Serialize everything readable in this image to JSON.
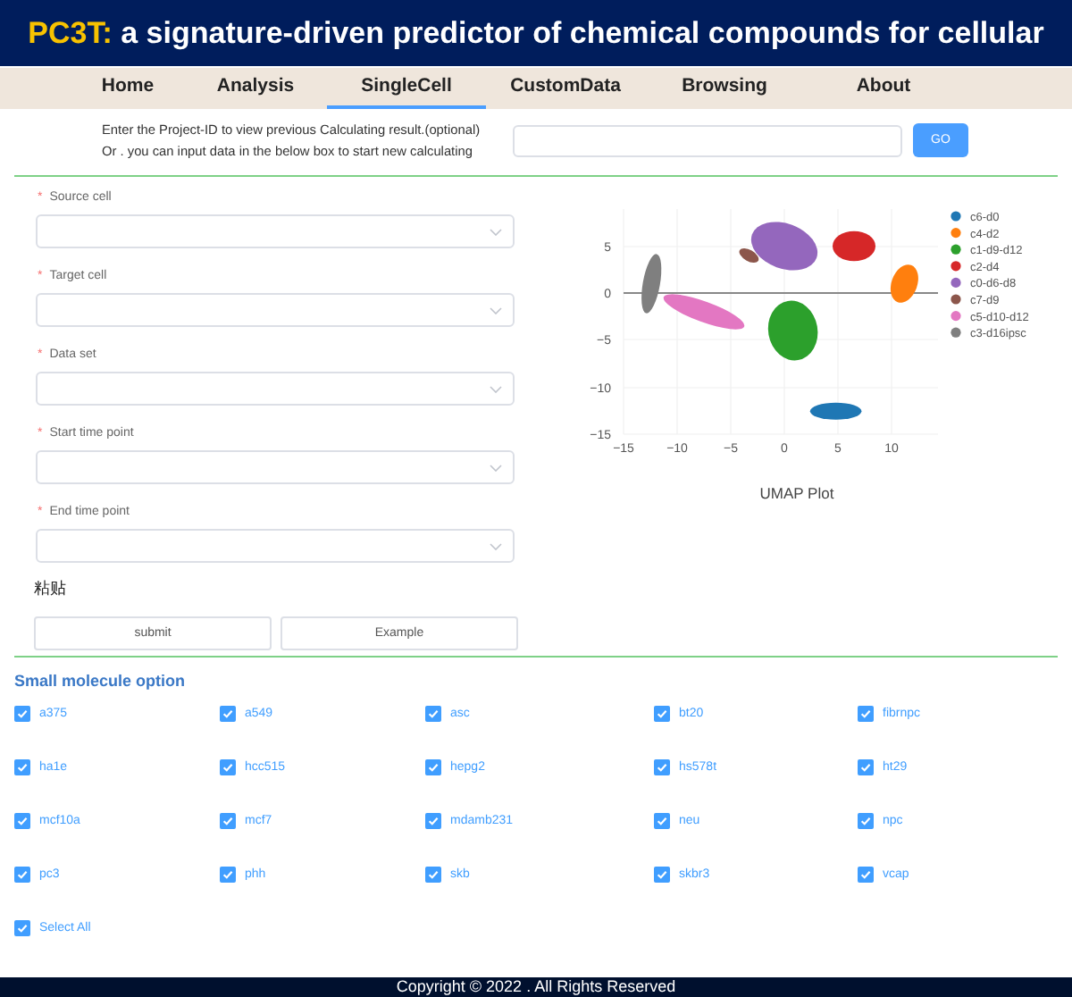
{
  "header": {
    "title_prefix": "PC3T:",
    "title": "a signature-driven predictor of chemical compounds for cellular"
  },
  "nav": [
    {
      "label": "Home",
      "selected": false
    },
    {
      "label": "Analysis",
      "selected": false
    },
    {
      "label": "SingleCell",
      "selected": true
    },
    {
      "label": "CustomData",
      "selected": false
    },
    {
      "label": "Browsing",
      "selected": false
    },
    {
      "label": "About",
      "selected": false
    }
  ],
  "project": {
    "lines": [
      "Enter the Project-ID to view previous Calculating result.(optional)",
      "Or . you can input data in the below box to start new calculating"
    ],
    "button": "GO"
  },
  "form": {
    "fields": [
      {
        "label": "Source cell",
        "required_mark": "*"
      },
      {
        "label": "Target cell",
        "required_mark": "*"
      },
      {
        "label": "Data set",
        "required_mark": "*"
      },
      {
        "label": "Start time point",
        "required_mark": "*"
      },
      {
        "label": "End time point",
        "required_mark": "*"
      }
    ],
    "paste_label": "粘贴",
    "buttons": [
      "submit",
      "Example"
    ]
  },
  "plot": {
    "caption": "UMAP Plot",
    "xticks": [
      "−15",
      "−10",
      "−5",
      "0",
      "5",
      "10"
    ],
    "yticks": [
      "5",
      "0",
      "−5",
      "−10",
      "−15"
    ],
    "legend": [
      {
        "label": "c6-d0",
        "color": "#1f77b4"
      },
      {
        "label": "c4-d2",
        "color": "#ff7f0e"
      },
      {
        "label": "c1-d9-d12",
        "color": "#2ca02c"
      },
      {
        "label": "c2-d4",
        "color": "#d62728"
      },
      {
        "label": "c0-d6-d8",
        "color": "#9467bd"
      },
      {
        "label": "c7-d9",
        "color": "#8c564b"
      },
      {
        "label": "c5-d10-d12",
        "color": "#e377c2"
      },
      {
        "label": "c3-d16ipsc",
        "color": "#7f7f7f"
      }
    ]
  },
  "molecules": {
    "title": "Small molecule option",
    "options": [
      {
        "label": "a375",
        "checked": true
      },
      {
        "label": "a549",
        "checked": true
      },
      {
        "label": "asc",
        "checked": true
      },
      {
        "label": "bt20",
        "checked": true
      },
      {
        "label": "fibrnpc",
        "checked": true
      },
      {
        "label": "ha1e",
        "checked": true
      },
      {
        "label": "hcc515",
        "checked": true
      },
      {
        "label": "hepg2",
        "checked": true
      },
      {
        "label": "hs578t",
        "checked": true
      },
      {
        "label": "ht29",
        "checked": true
      },
      {
        "label": "mcf10a",
        "checked": true
      },
      {
        "label": "mcf7",
        "checked": true
      },
      {
        "label": "mdamb231",
        "checked": true
      },
      {
        "label": "neu",
        "checked": true
      },
      {
        "label": "npc",
        "checked": true
      },
      {
        "label": "pc3",
        "checked": true
      },
      {
        "label": "phh",
        "checked": true
      },
      {
        "label": "skb",
        "checked": true
      },
      {
        "label": "skbr3",
        "checked": true
      },
      {
        "label": "vcap",
        "checked": true
      }
    ],
    "select_all": {
      "label": "Select All",
      "checked": true
    }
  },
  "footer": "Copyright © 2022 . All Rights Reserved"
}
